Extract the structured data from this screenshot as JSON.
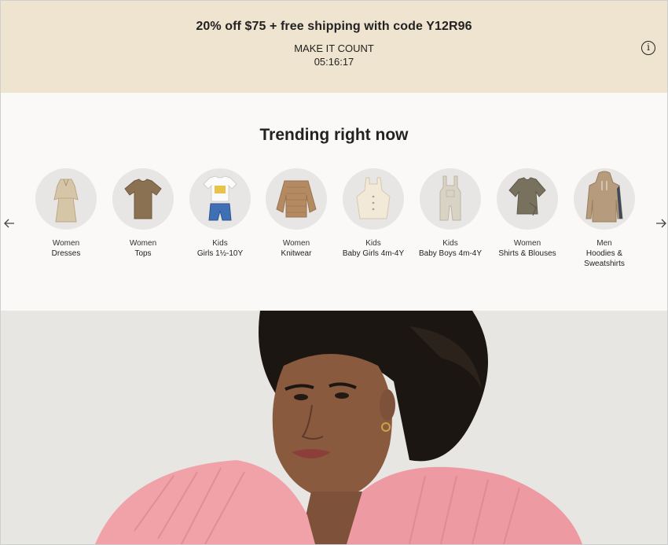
{
  "promo": {
    "headline": "20% off $75 + free shipping with code Y12R96",
    "subline": "MAKE IT COUNT",
    "timer": "05:16:17",
    "info_icon": "i",
    "background": "#efe4cf"
  },
  "trending": {
    "title": "Trending right now",
    "prev_icon": "arrow-left-icon",
    "next_icon": "arrow-right-icon",
    "items": [
      {
        "line1": "Women",
        "line2": "Dresses",
        "icon": "dress-icon"
      },
      {
        "line1": "Women",
        "line2": "Tops",
        "icon": "tshirt-icon"
      },
      {
        "line1": "Kids",
        "line2": "Girls 1½-10Y",
        "icon": "kids-outfit-icon"
      },
      {
        "line1": "Women",
        "line2": "Knitwear",
        "icon": "sweater-icon"
      },
      {
        "line1": "Kids",
        "line2": "Baby Girls 4m-4Y",
        "icon": "baby-dress-icon"
      },
      {
        "line1": "Kids",
        "line2": "Baby Boys 4m-4Y",
        "icon": "overalls-icon"
      },
      {
        "line1": "Women",
        "line2": "Shirts & Blouses",
        "icon": "blouse-icon"
      },
      {
        "line1": "Men",
        "line2": "Hoodies & Sweatshirts",
        "icon": "hoodie-icon"
      }
    ]
  },
  "hero": {
    "image": "model-pink-cardigan-photo"
  }
}
